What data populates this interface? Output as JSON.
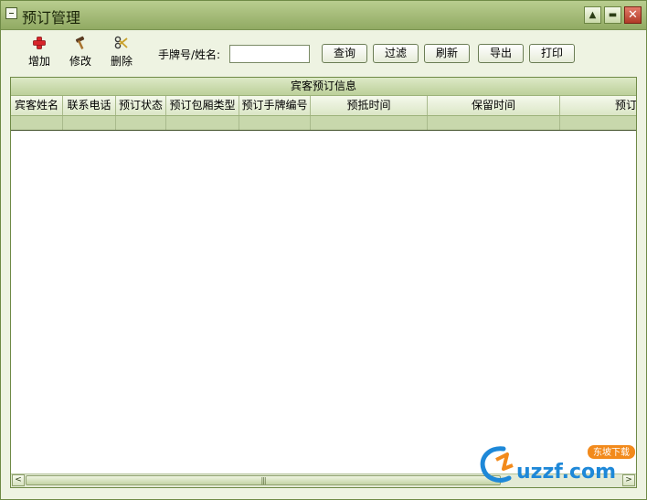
{
  "window": {
    "title": "预订管理",
    "min_glyph": "▲",
    "max_glyph": "▬",
    "close_glyph": "✕"
  },
  "toolbar": {
    "add_label": "增加",
    "edit_label": "修改",
    "delete_label": "删除",
    "search_label": "手牌号/姓名:",
    "search_value": "",
    "query_label": "查询",
    "filter_label": "过滤",
    "refresh_label": "刷新",
    "export_label": "导出",
    "print_label": "打印"
  },
  "grid": {
    "caption": "宾客预订信息",
    "columns": [
      "宾客姓名",
      "联系电话",
      "预订状态",
      "预订包厢类型",
      "预订手牌编号",
      "预抵时间",
      "保留时间",
      "预订"
    ]
  },
  "scrollbar": {
    "left_glyph": "<",
    "right_glyph": ">",
    "thumb_grip": "|||"
  },
  "watermark": {
    "text": "uzzf.com",
    "badge": "东坡下载"
  },
  "colors": {
    "titlebar": "#a4bb78",
    "frame": "#eef3e2",
    "accent_row": "#c8d8ac",
    "close": "#c34a36",
    "watermark_blue": "#1e88d8",
    "watermark_orange": "#f28a1c"
  }
}
